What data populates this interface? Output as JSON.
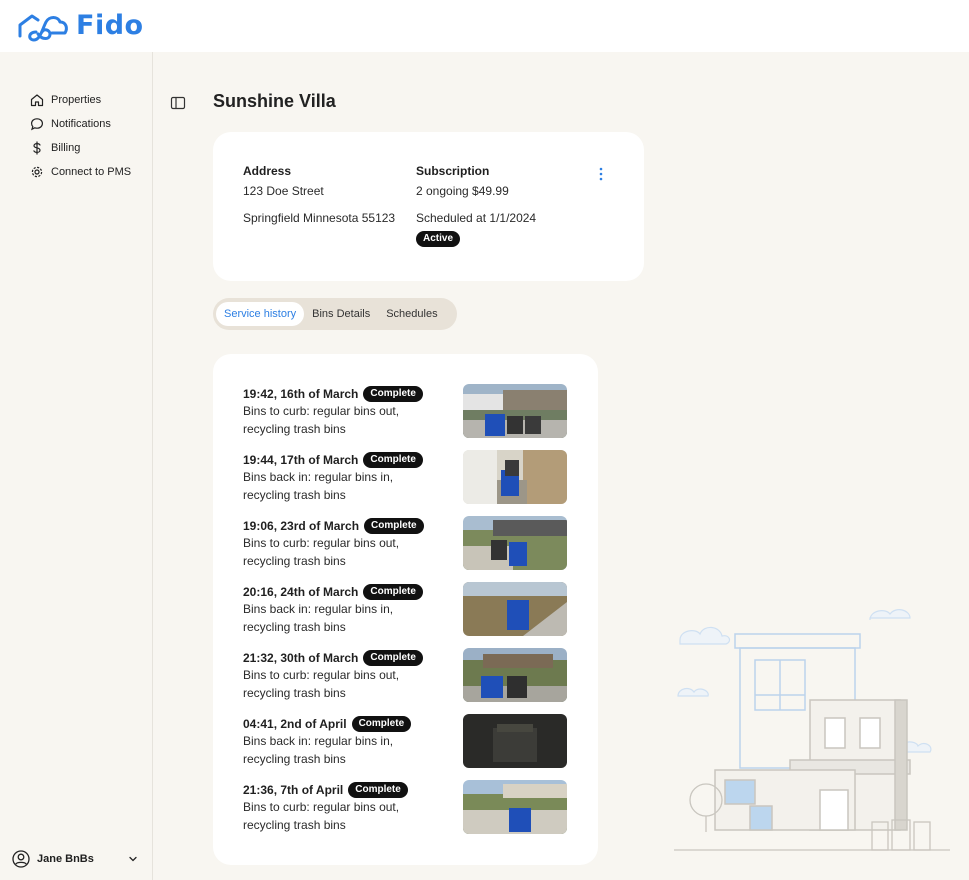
{
  "app": {
    "name": "Fido"
  },
  "sidebar": {
    "items": [
      {
        "label": "Properties",
        "icon": "home-icon"
      },
      {
        "label": "Notifications",
        "icon": "chat-bubble-icon"
      },
      {
        "label": "Billing",
        "icon": "dollar-icon"
      },
      {
        "label": "Connect to PMS",
        "icon": "gear-icon"
      }
    ],
    "user": {
      "name": "Jane BnBs"
    }
  },
  "page": {
    "title": "Sunshine Villa"
  },
  "property": {
    "address_label": "Address",
    "address_line1": "123 Doe Street",
    "address_line2": "Springfield Minnesota 55123",
    "subscription_label": "Subscription",
    "subscription_line1": "2 ongoing $49.99",
    "subscription_line2": "Scheduled at 1/1/2024",
    "status": "Active"
  },
  "tabs": [
    {
      "label": "Service history",
      "active": true
    },
    {
      "label": "Bins Details",
      "active": false
    },
    {
      "label": "Schedules",
      "active": false
    }
  ],
  "history": [
    {
      "time": "19:42, 16th of March",
      "status": "Complete",
      "desc": "Bins to curb: regular bins out, recycling trash bins"
    },
    {
      "time": "19:44, 17th of March",
      "status": "Complete",
      "desc": "Bins back in: regular bins in, recycling trash bins"
    },
    {
      "time": "19:06, 23rd of March",
      "status": "Complete",
      "desc": "Bins to curb: regular bins out, recycling trash bins"
    },
    {
      "time": "20:16, 24th of March",
      "status": "Complete",
      "desc": "Bins back in: regular bins in, recycling trash bins"
    },
    {
      "time": "21:32, 30th of March",
      "status": "Complete",
      "desc": "Bins to curb: regular bins out, recycling trash bins"
    },
    {
      "time": "04:41, 2nd of April",
      "status": "Complete",
      "desc": "Bins back in: regular bins in, recycling trash bins"
    },
    {
      "time": "21:36, 7th of April",
      "status": "Complete",
      "desc": "Bins to curb: regular bins out, recycling trash bins"
    }
  ],
  "colors": {
    "accent": "#2d7fe3",
    "badge": "#111111",
    "background": "#f8f6f1",
    "tab_track": "#e8e2d8"
  }
}
